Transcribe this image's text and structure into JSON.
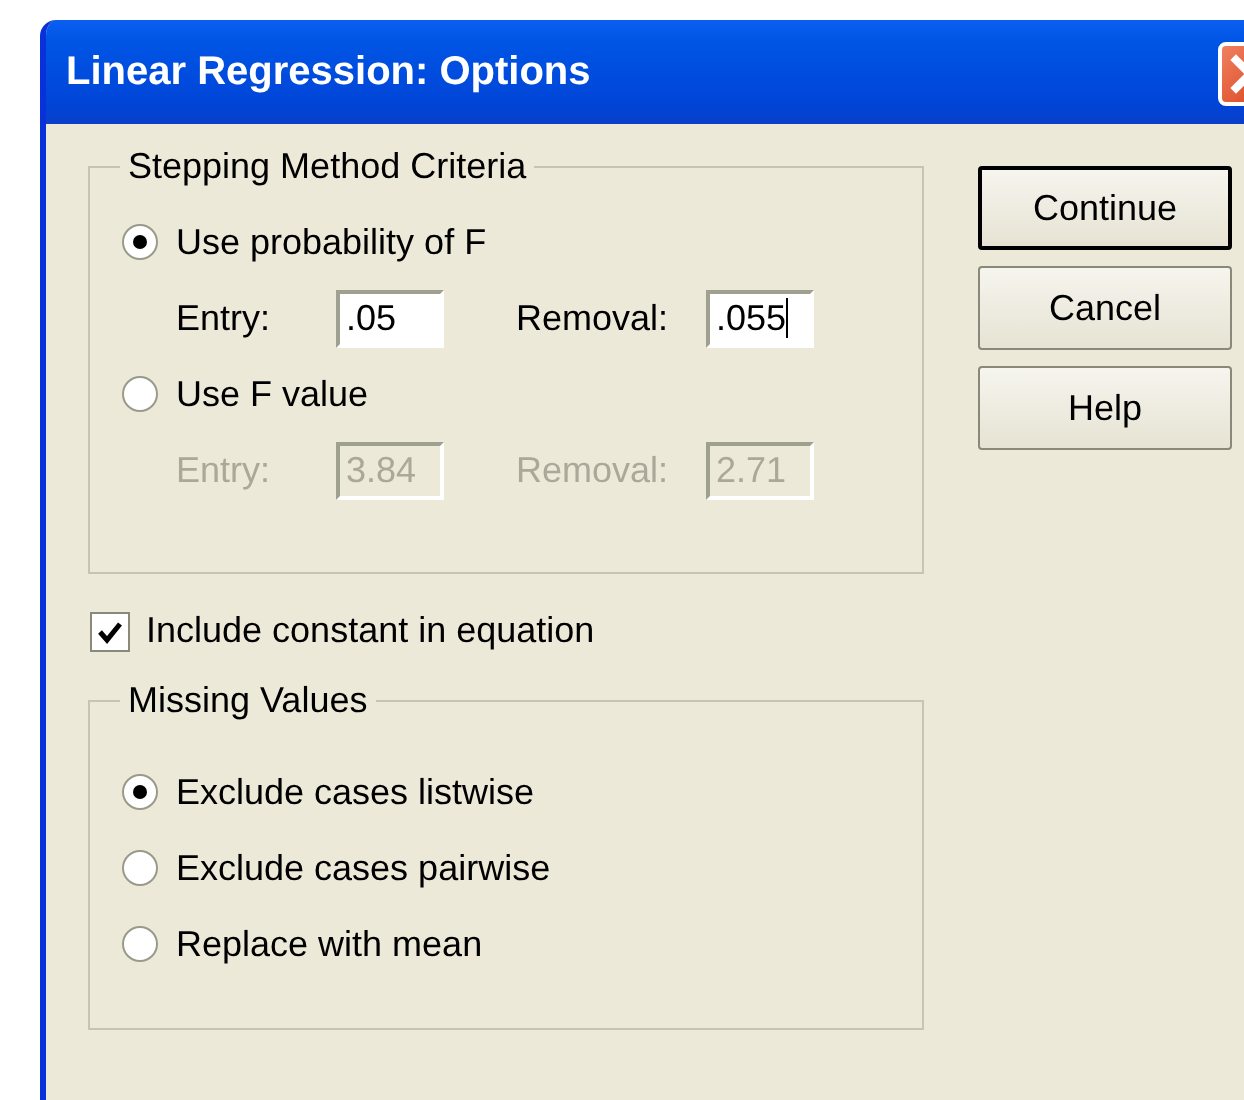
{
  "window": {
    "title": "Linear Regression: Options"
  },
  "stepping_group": {
    "title": "Stepping Method Criteria",
    "options": [
      {
        "label": "Use probability of F",
        "selected": true,
        "disabled": false,
        "entry": {
          "label": "Entry:",
          "value": ".05",
          "focused": false
        },
        "removal": {
          "label": "Removal:",
          "value": ".055",
          "focused": true
        }
      },
      {
        "label": "Use F value",
        "selected": false,
        "disabled": true,
        "entry": {
          "label": "Entry:",
          "value": "3.84",
          "focused": false
        },
        "removal": {
          "label": "Removal:",
          "value": "2.71",
          "focused": false
        }
      }
    ]
  },
  "include_constant": {
    "label": "Include constant in equation",
    "checked": true
  },
  "missing_group": {
    "title": "Missing Values",
    "options": [
      {
        "label": "Exclude cases listwise",
        "selected": true
      },
      {
        "label": "Exclude cases pairwise",
        "selected": false
      },
      {
        "label": "Replace with mean",
        "selected": false
      }
    ]
  },
  "buttons": [
    {
      "label": "Continue",
      "default": true
    },
    {
      "label": "Cancel",
      "default": false
    },
    {
      "label": "Help",
      "default": false
    }
  ]
}
